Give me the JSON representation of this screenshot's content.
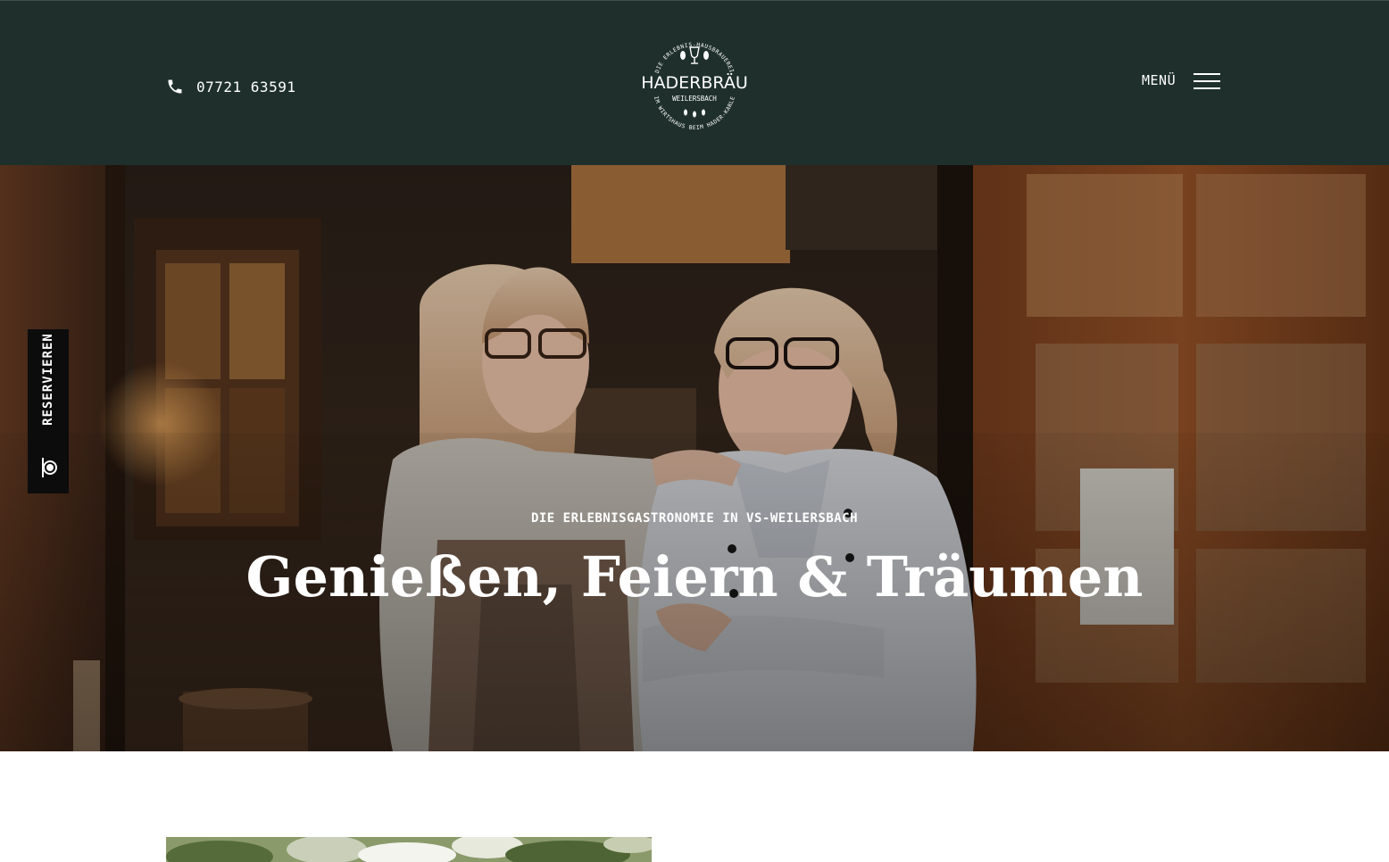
{
  "header": {
    "phone": {
      "icon": "phone-icon",
      "number": "07721 63591"
    },
    "logo": {
      "wordmark": "HADERBRÄU",
      "location": "WEILERSBACH",
      "ring_top": "DIE ERLEBNIS-HAUSBRAUEREI",
      "ring_bottom": "IM WIRTSHAUS BEIM HADER-KARLE"
    },
    "menu": {
      "label": "MENÜ",
      "icon": "hamburger-menu-icon"
    }
  },
  "hero": {
    "eyebrow": "DIE ERLEBNISGASTRONOMIE IN VS-WEILERSBACH",
    "title": "Genießen, Feiern & Träumen"
  },
  "reserve_tab": {
    "label": "RESERVIEREN",
    "icon": "plate-cutlery-icon"
  },
  "colors": {
    "header_bg": "#1f302c",
    "reserve_bg": "#0c0c0c",
    "text_light": "#ffffff"
  }
}
